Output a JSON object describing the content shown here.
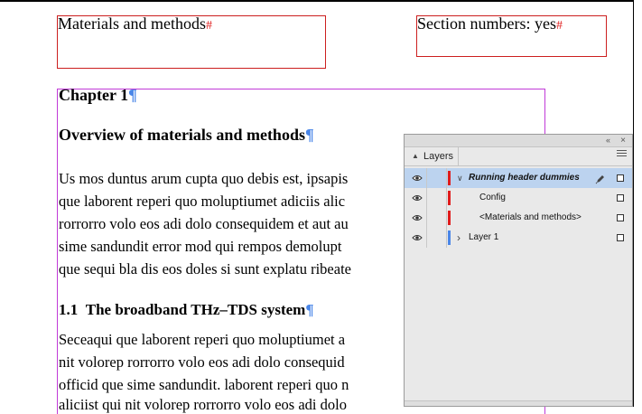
{
  "document": {
    "header_frame_1": {
      "text": "Materials and methods",
      "mark": "#"
    },
    "header_frame_2": {
      "text": "Section numbers: yes",
      "mark": "#"
    },
    "chapter": "Chapter 1",
    "overview": "Overview of materials and methods",
    "para1": [
      "Us mos duntus arum cupta quo debis est, ipsapis",
      "que laborent reperi quo moluptiumet adiciis alic",
      "rorrorro volo eos adi dolo consequidem et aut au",
      "sime sandundit error mod qui rempos demolupt",
      "que sequi bla dis eos doles si sunt explatu ribeate"
    ],
    "section_number": "1.1",
    "section_title": "The broadband THz–TDS system",
    "para2": [
      "Seceaqui que laborent reperi quo moluptiumet a",
      "nit volorep rorrorro volo eos adi dolo consequid",
      "officid que sime sandundit. laborent reperi quo n",
      "aliciist qui nit volorep rorrorro volo eos adi dolo"
    ],
    "pilcrow": "¶"
  },
  "layers_panel": {
    "title": "Layers",
    "collapse_glyph": "«",
    "close_glyph": "×",
    "layers": [
      {
        "label": "Running header dummies",
        "expanded": true,
        "color": "#e01b1b",
        "selected": true
      },
      {
        "label": "Config",
        "color": "#e01b1b"
      },
      {
        "label": "<Materials and methods>",
        "color": "#e01b1b"
      },
      {
        "label": "Layer 1",
        "expanded": false,
        "color": "#4a86e8"
      }
    ],
    "expanded_chevron": "∨",
    "collapsed_chevron": "›"
  }
}
